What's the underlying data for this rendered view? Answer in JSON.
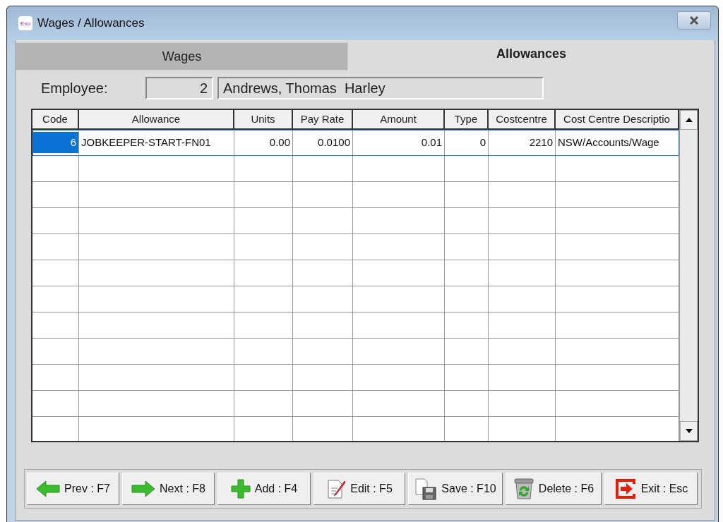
{
  "window": {
    "title": "Wages / Allowances",
    "app_badge": "Exo"
  },
  "tabs": [
    {
      "label": "Wages",
      "selected": false
    },
    {
      "label": "Allowances",
      "selected": true
    }
  ],
  "employee": {
    "label": "Employee:",
    "number": "2",
    "name": "Andrews, Thomas  Harley"
  },
  "table": {
    "columns": [
      {
        "label": "Code"
      },
      {
        "label": "Allowance"
      },
      {
        "label": "Units"
      },
      {
        "label": "Pay Rate"
      },
      {
        "label": "Amount"
      },
      {
        "label": "Type"
      },
      {
        "label": "Costcentre"
      },
      {
        "label": "Cost Centre Descriptio"
      }
    ],
    "rows": [
      {
        "selected": true,
        "cells": [
          "6",
          "JOBKEEPER-START-FN01",
          "0.00",
          "0.0100",
          "0.01",
          "0",
          "2210",
          "NSW/Accounts/Wage"
        ]
      }
    ]
  },
  "buttons": [
    {
      "kind": "prev",
      "label": "Prev : F7"
    },
    {
      "kind": "next",
      "label": "Next : F8"
    },
    {
      "kind": "add",
      "label": "Add : F4"
    },
    {
      "kind": "edit",
      "label": "Edit : F5"
    },
    {
      "kind": "save",
      "label": "Save : F10"
    },
    {
      "kind": "delete",
      "label": "Delete : F6"
    },
    {
      "kind": "exit",
      "label": "Exit : Esc"
    }
  ]
}
